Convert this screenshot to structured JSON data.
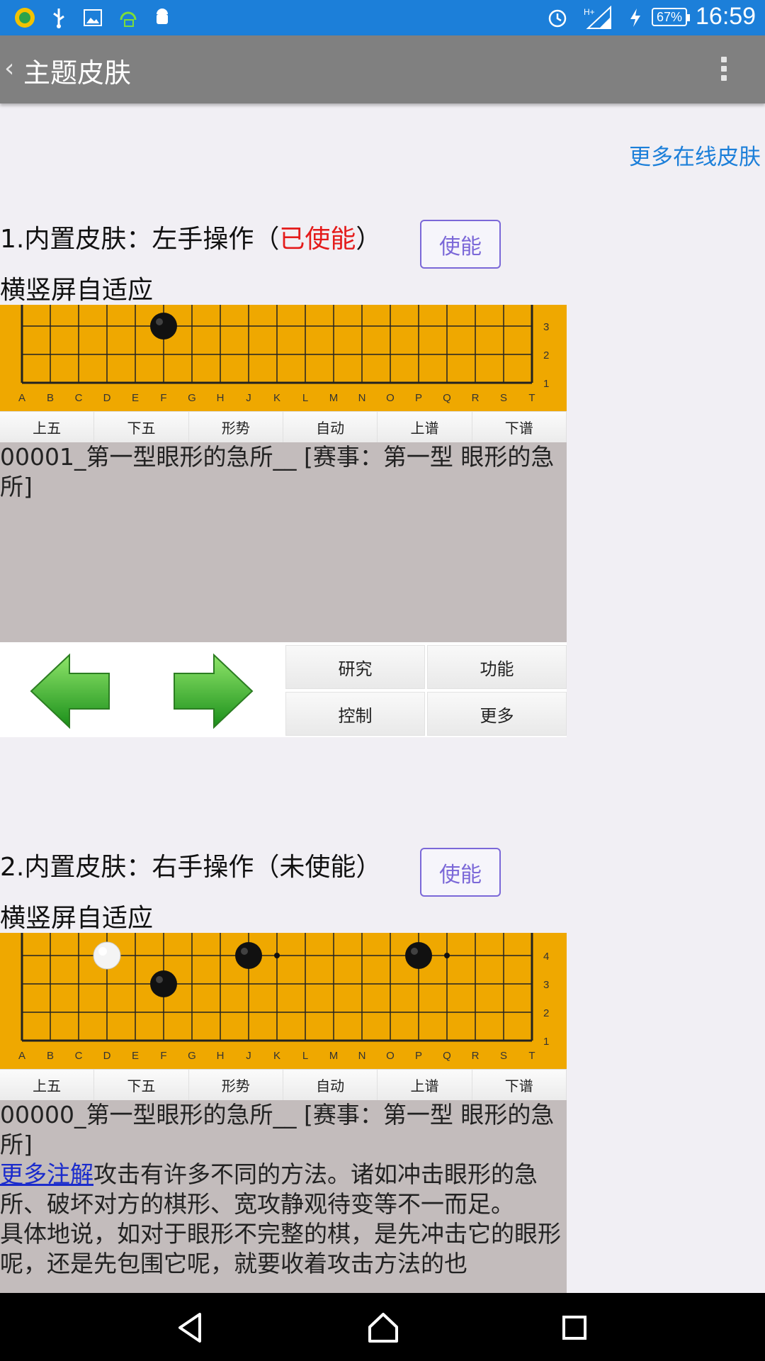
{
  "status_bar": {
    "icons": [
      "app-logo-icon",
      "usb-icon",
      "image-icon",
      "headset-icon",
      "android-icon",
      "alarm-icon",
      "signal-icon",
      "charging-icon"
    ],
    "network": "H+",
    "battery": "67%",
    "time": "16:59"
  },
  "header": {
    "title": "主题皮肤",
    "back_icon": "back-chevron-icon",
    "menu_icon": "overflow-menu-icon"
  },
  "online_link": "更多在线皮肤",
  "skins": [
    {
      "title_prefix": "1.内置皮肤：左手操作（",
      "status": "已使能",
      "status_color": "#e41b1b",
      "title_suffix": "）",
      "enable_button": "使能",
      "subtitle": "横竖屏自适应",
      "board": {
        "columns": [
          "A",
          "B",
          "C",
          "D",
          "E",
          "F",
          "G",
          "H",
          "J",
          "K",
          "L",
          "M",
          "N",
          "O",
          "P",
          "Q",
          "R",
          "S",
          "T"
        ],
        "rows": [
          "3",
          "2",
          "1"
        ],
        "stones": [
          {
            "color": "black",
            "col": "F",
            "row": "3"
          }
        ]
      },
      "toolbar": [
        "上五",
        "下五",
        "形势",
        "自动",
        "上谱",
        "下谱"
      ],
      "comment": "00001_第一型眼形的急所__ [赛事：第一型 眼形的急所]",
      "controls": {
        "prev_icon": "green-left-arrow-icon",
        "next_icon": "green-right-arrow-icon",
        "buttons": [
          "研究",
          "功能",
          "控制",
          "更多"
        ]
      }
    },
    {
      "title_prefix": "2.内置皮肤：右手操作（",
      "status": "未使能",
      "title_suffix": "）",
      "enable_button": "使能",
      "subtitle": "横竖屏自适应",
      "board": {
        "columns": [
          "A",
          "B",
          "C",
          "D",
          "E",
          "F",
          "G",
          "H",
          "J",
          "K",
          "L",
          "M",
          "N",
          "O",
          "P",
          "Q",
          "R",
          "S",
          "T"
        ],
        "rows": [
          "4",
          "3",
          "2",
          "1"
        ],
        "stones": [
          {
            "color": "white",
            "col": "D",
            "row": "4"
          },
          {
            "color": "black",
            "col": "J",
            "row": "4"
          },
          {
            "color": "black",
            "col": "P",
            "row": "4"
          },
          {
            "color": "black",
            "col": "F",
            "row": "3"
          }
        ],
        "star_points": [
          {
            "col": "K",
            "row": "4"
          },
          {
            "col": "Q",
            "row": "4"
          }
        ]
      },
      "toolbar": [
        "上五",
        "下五",
        "形势",
        "自动",
        "上谱",
        "下谱"
      ],
      "comment_title": "00000_第一型眼形的急所__ [赛事：第一型 眼形的急所]",
      "comment_link": "更多注解",
      "comment_body": "攻击有许多不同的方法。诸如冲击眼形的急所、破坏对方的棋形、宽攻静观待变等不一而足。",
      "comment_body2": "具体地说，如对于眼形不完整的棋，是先冲击它的眼形呢，还是先包围它呢，就要收着攻击方法的也"
    }
  ],
  "nav_bar": {
    "buttons": [
      "back-triangle-icon",
      "home-icon",
      "recents-square-icon"
    ]
  }
}
